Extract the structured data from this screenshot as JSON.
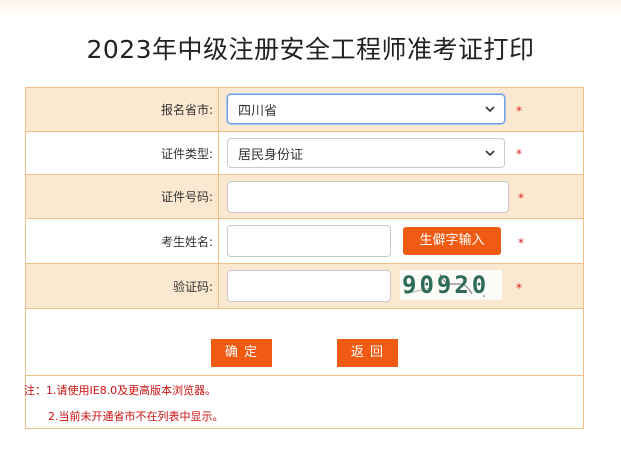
{
  "page": {
    "title": "2023年中级注册安全工程师准考证打印"
  },
  "form": {
    "province": {
      "label": "报名省市:",
      "value": "四川省"
    },
    "id_type": {
      "label": "证件类型:",
      "value": "居民身份证"
    },
    "id_number": {
      "label": "证件号码:",
      "value": ""
    },
    "name": {
      "label": "考生姓名:",
      "value": "",
      "rare_char_button": "生僻字输入"
    },
    "captcha": {
      "label": "验证码:",
      "value": "",
      "image_text": "90920"
    },
    "required_mark": "*",
    "confirm_button": "确 定",
    "back_button": "返 回"
  },
  "notes": {
    "line1": "注：1.请使用IE8.0及更高版本浏览器。",
    "line2": "2.当前未开通省市不在列表中显示。"
  },
  "colors": {
    "accent": "#f05a12",
    "row_alt": "#fbe8d1",
    "border": "#f1c08a",
    "note": "#cc1010"
  }
}
